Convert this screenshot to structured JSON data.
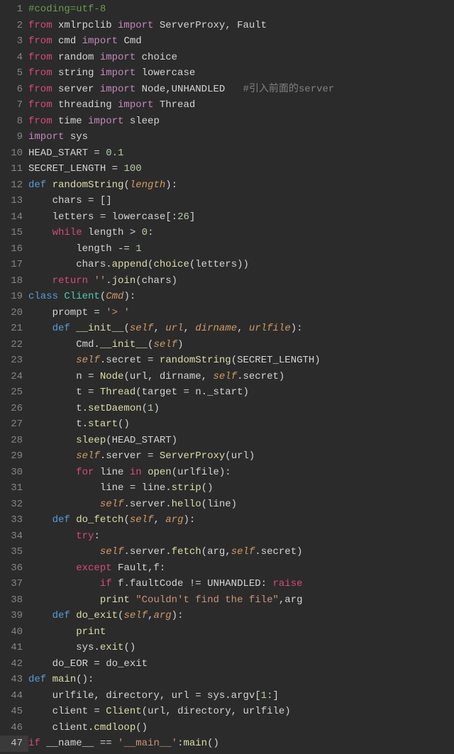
{
  "language": "python",
  "highlighted_line": 47,
  "lines": [
    {
      "n": 1,
      "tokens": [
        [
          "cm",
          "#coding=utf-8"
        ]
      ]
    },
    {
      "n": 2,
      "tokens": [
        [
          "kw-pink",
          "from"
        ],
        [
          "ident",
          " xmlrpclib "
        ],
        [
          "kw-import",
          "import"
        ],
        [
          "ident",
          " ServerProxy, Fault"
        ]
      ]
    },
    {
      "n": 3,
      "tokens": [
        [
          "kw-pink",
          "from"
        ],
        [
          "ident",
          " cmd "
        ],
        [
          "kw-import",
          "import"
        ],
        [
          "ident",
          " Cmd"
        ]
      ]
    },
    {
      "n": 4,
      "tokens": [
        [
          "kw-pink",
          "from"
        ],
        [
          "ident",
          " random "
        ],
        [
          "kw-import",
          "import"
        ],
        [
          "ident",
          " choice"
        ]
      ]
    },
    {
      "n": 5,
      "tokens": [
        [
          "kw-pink",
          "from"
        ],
        [
          "ident",
          " string "
        ],
        [
          "kw-import",
          "import"
        ],
        [
          "ident",
          " lowercase"
        ]
      ]
    },
    {
      "n": 6,
      "tokens": [
        [
          "kw-pink",
          "from"
        ],
        [
          "ident",
          " server "
        ],
        [
          "kw-import",
          "import"
        ],
        [
          "ident",
          " Node,UNHANDLED   "
        ],
        [
          "cm2",
          "#引入前面的server"
        ]
      ]
    },
    {
      "n": 7,
      "tokens": [
        [
          "kw-pink",
          "from"
        ],
        [
          "ident",
          " threading "
        ],
        [
          "kw-import",
          "import"
        ],
        [
          "ident",
          " Thread"
        ]
      ]
    },
    {
      "n": 8,
      "tokens": [
        [
          "kw-pink",
          "from"
        ],
        [
          "ident",
          " time "
        ],
        [
          "kw-import",
          "import"
        ],
        [
          "ident",
          " sleep"
        ]
      ]
    },
    {
      "n": 9,
      "tokens": [
        [
          "kw-import",
          "import"
        ],
        [
          "ident",
          " sys"
        ]
      ]
    },
    {
      "n": 10,
      "tokens": [
        [
          "ident",
          "HEAD_START "
        ],
        [
          "op",
          "="
        ],
        [
          "ident",
          " "
        ],
        [
          "num",
          "0.1"
        ]
      ]
    },
    {
      "n": 11,
      "tokens": [
        [
          "ident",
          "SECRET_LENGTH "
        ],
        [
          "op",
          "="
        ],
        [
          "ident",
          " "
        ],
        [
          "num",
          "100"
        ]
      ]
    },
    {
      "n": 12,
      "tokens": [
        [
          "kw-def",
          "def "
        ],
        [
          "fn",
          "randomString"
        ],
        [
          "op",
          "("
        ],
        [
          "self-ital",
          "length"
        ],
        [
          "op",
          "):"
        ]
      ]
    },
    {
      "n": 13,
      "tokens": [
        [
          "ident",
          "    chars "
        ],
        [
          "op",
          "="
        ],
        [
          "ident",
          " []"
        ]
      ]
    },
    {
      "n": 14,
      "tokens": [
        [
          "ident",
          "    letters "
        ],
        [
          "op",
          "="
        ],
        [
          "ident",
          " lowercase[:"
        ],
        [
          "num",
          "26"
        ],
        [
          "ident",
          "]"
        ]
      ]
    },
    {
      "n": 15,
      "tokens": [
        [
          "ident",
          "    "
        ],
        [
          "kw-pink",
          "while"
        ],
        [
          "ident",
          " length "
        ],
        [
          "op",
          ">"
        ],
        [
          "ident",
          " "
        ],
        [
          "num",
          "0"
        ],
        [
          "op",
          ":"
        ]
      ]
    },
    {
      "n": 16,
      "tokens": [
        [
          "ident",
          "        length "
        ],
        [
          "op",
          "-="
        ],
        [
          "ident",
          " "
        ],
        [
          "num",
          "1"
        ]
      ]
    },
    {
      "n": 17,
      "tokens": [
        [
          "ident",
          "        chars."
        ],
        [
          "meth",
          "append"
        ],
        [
          "op",
          "("
        ],
        [
          "meth",
          "choice"
        ],
        [
          "op",
          "("
        ],
        [
          "ident",
          "letters))"
        ]
      ]
    },
    {
      "n": 18,
      "tokens": [
        [
          "ident",
          "    "
        ],
        [
          "kw-pink",
          "return"
        ],
        [
          "ident",
          " "
        ],
        [
          "str",
          "''"
        ],
        [
          "ident",
          "."
        ],
        [
          "meth",
          "join"
        ],
        [
          "op",
          "("
        ],
        [
          "ident",
          "chars)"
        ]
      ]
    },
    {
      "n": 19,
      "tokens": [
        [
          "kw-def",
          "class "
        ],
        [
          "cls",
          "Client"
        ],
        [
          "op",
          "("
        ],
        [
          "self-ital",
          "Cmd"
        ],
        [
          "op",
          "):"
        ]
      ]
    },
    {
      "n": 20,
      "tokens": [
        [
          "ident",
          "    prompt "
        ],
        [
          "op",
          "="
        ],
        [
          "ident",
          " "
        ],
        [
          "str",
          "'> '"
        ]
      ]
    },
    {
      "n": 21,
      "tokens": [
        [
          "ident",
          "    "
        ],
        [
          "kw-def",
          "def "
        ],
        [
          "fn",
          "__init__"
        ],
        [
          "op",
          "("
        ],
        [
          "self-ital",
          "self"
        ],
        [
          "op",
          ", "
        ],
        [
          "self-ital",
          "url"
        ],
        [
          "op",
          ", "
        ],
        [
          "self-ital",
          "dirname"
        ],
        [
          "op",
          ", "
        ],
        [
          "self-ital",
          "urlfile"
        ],
        [
          "op",
          "):"
        ]
      ]
    },
    {
      "n": 22,
      "tokens": [
        [
          "ident",
          "        Cmd."
        ],
        [
          "meth",
          "__init__"
        ],
        [
          "op",
          "("
        ],
        [
          "self-ital",
          "self"
        ],
        [
          "op",
          ")"
        ]
      ]
    },
    {
      "n": 23,
      "tokens": [
        [
          "ident",
          "        "
        ],
        [
          "self-ital",
          "self"
        ],
        [
          "ident",
          ".secret "
        ],
        [
          "op",
          "="
        ],
        [
          "ident",
          " "
        ],
        [
          "meth",
          "randomString"
        ],
        [
          "op",
          "("
        ],
        [
          "ident",
          "SECRET_LENGTH)"
        ]
      ]
    },
    {
      "n": 24,
      "tokens": [
        [
          "ident",
          "        n "
        ],
        [
          "op",
          "="
        ],
        [
          "ident",
          " "
        ],
        [
          "meth",
          "Node"
        ],
        [
          "op",
          "("
        ],
        [
          "ident",
          "url, dirname, "
        ],
        [
          "self-ital",
          "self"
        ],
        [
          "ident",
          ".secret)"
        ]
      ]
    },
    {
      "n": 25,
      "tokens": [
        [
          "ident",
          "        t "
        ],
        [
          "op",
          "="
        ],
        [
          "ident",
          " "
        ],
        [
          "meth",
          "Thread"
        ],
        [
          "op",
          "("
        ],
        [
          "ident",
          "target "
        ],
        [
          "op",
          "="
        ],
        [
          "ident",
          " n._start)"
        ]
      ]
    },
    {
      "n": 26,
      "tokens": [
        [
          "ident",
          "        t."
        ],
        [
          "meth",
          "setDaemon"
        ],
        [
          "op",
          "("
        ],
        [
          "num",
          "1"
        ],
        [
          "op",
          ")"
        ]
      ]
    },
    {
      "n": 27,
      "tokens": [
        [
          "ident",
          "        t."
        ],
        [
          "meth",
          "start"
        ],
        [
          "op",
          "()"
        ]
      ]
    },
    {
      "n": 28,
      "tokens": [
        [
          "ident",
          "        "
        ],
        [
          "meth",
          "sleep"
        ],
        [
          "op",
          "("
        ],
        [
          "ident",
          "HEAD_START)"
        ]
      ]
    },
    {
      "n": 29,
      "tokens": [
        [
          "ident",
          "        "
        ],
        [
          "self-ital",
          "self"
        ],
        [
          "ident",
          ".server "
        ],
        [
          "op",
          "="
        ],
        [
          "ident",
          " "
        ],
        [
          "meth",
          "ServerProxy"
        ],
        [
          "op",
          "("
        ],
        [
          "ident",
          "url)"
        ]
      ]
    },
    {
      "n": 30,
      "tokens": [
        [
          "ident",
          "        "
        ],
        [
          "kw-pink",
          "for"
        ],
        [
          "ident",
          " line "
        ],
        [
          "kw-pink",
          "in"
        ],
        [
          "ident",
          " "
        ],
        [
          "builtin",
          "open"
        ],
        [
          "op",
          "("
        ],
        [
          "ident",
          "urlfile):"
        ]
      ]
    },
    {
      "n": 31,
      "tokens": [
        [
          "ident",
          "            line "
        ],
        [
          "op",
          "="
        ],
        [
          "ident",
          " line."
        ],
        [
          "meth",
          "strip"
        ],
        [
          "op",
          "()"
        ]
      ]
    },
    {
      "n": 32,
      "tokens": [
        [
          "ident",
          "            "
        ],
        [
          "self-ital",
          "self"
        ],
        [
          "ident",
          ".server."
        ],
        [
          "meth",
          "hello"
        ],
        [
          "op",
          "("
        ],
        [
          "ident",
          "line)"
        ]
      ]
    },
    {
      "n": 33,
      "tokens": [
        [
          "ident",
          "    "
        ],
        [
          "kw-def",
          "def "
        ],
        [
          "fn",
          "do_fetch"
        ],
        [
          "op",
          "("
        ],
        [
          "self-ital",
          "self"
        ],
        [
          "op",
          ", "
        ],
        [
          "self-ital",
          "arg"
        ],
        [
          "op",
          "):"
        ]
      ]
    },
    {
      "n": 34,
      "tokens": [
        [
          "ident",
          "        "
        ],
        [
          "kw-pink",
          "try"
        ],
        [
          "op",
          ":"
        ]
      ]
    },
    {
      "n": 35,
      "tokens": [
        [
          "ident",
          "            "
        ],
        [
          "self-ital",
          "self"
        ],
        [
          "ident",
          ".server."
        ],
        [
          "meth",
          "fetch"
        ],
        [
          "op",
          "("
        ],
        [
          "ident",
          "arg,"
        ],
        [
          "self-ital",
          "self"
        ],
        [
          "ident",
          ".secret)"
        ]
      ]
    },
    {
      "n": 36,
      "tokens": [
        [
          "ident",
          "        "
        ],
        [
          "kw-pink",
          "except"
        ],
        [
          "ident",
          " Fault,f:"
        ]
      ]
    },
    {
      "n": 37,
      "tokens": [
        [
          "ident",
          "            "
        ],
        [
          "kw-pink",
          "if"
        ],
        [
          "ident",
          " f.faultCode "
        ],
        [
          "op",
          "!="
        ],
        [
          "ident",
          " UNHANDLED: "
        ],
        [
          "kw-pink",
          "raise"
        ]
      ]
    },
    {
      "n": 38,
      "tokens": [
        [
          "ident",
          "            "
        ],
        [
          "builtin",
          "print"
        ],
        [
          "ident",
          " "
        ],
        [
          "str",
          "\"Couldn't find the file\""
        ],
        [
          "ident",
          ",arg"
        ]
      ]
    },
    {
      "n": 39,
      "tokens": [
        [
          "ident",
          "    "
        ],
        [
          "kw-def",
          "def "
        ],
        [
          "fn",
          "do_exit"
        ],
        [
          "op",
          "("
        ],
        [
          "self-ital",
          "self"
        ],
        [
          "op",
          ","
        ],
        [
          "self-ital",
          "arg"
        ],
        [
          "op",
          "):"
        ]
      ]
    },
    {
      "n": 40,
      "tokens": [
        [
          "ident",
          "        "
        ],
        [
          "builtin",
          "print"
        ]
      ]
    },
    {
      "n": 41,
      "tokens": [
        [
          "ident",
          "        sys."
        ],
        [
          "meth",
          "exit"
        ],
        [
          "op",
          "()"
        ]
      ]
    },
    {
      "n": 42,
      "tokens": [
        [
          "ident",
          "    do_EOR "
        ],
        [
          "op",
          "="
        ],
        [
          "ident",
          " do_exit"
        ]
      ]
    },
    {
      "n": 43,
      "tokens": [
        [
          "kw-def",
          "def "
        ],
        [
          "fn",
          "main"
        ],
        [
          "op",
          "():"
        ]
      ]
    },
    {
      "n": 44,
      "tokens": [
        [
          "ident",
          "    urlfile, directory, url "
        ],
        [
          "op",
          "="
        ],
        [
          "ident",
          " sys.argv["
        ],
        [
          "num",
          "1"
        ],
        [
          "ident",
          ":]"
        ]
      ]
    },
    {
      "n": 45,
      "tokens": [
        [
          "ident",
          "    client "
        ],
        [
          "op",
          "="
        ],
        [
          "ident",
          " "
        ],
        [
          "meth",
          "Client"
        ],
        [
          "op",
          "("
        ],
        [
          "ident",
          "url, directory, urlfile)"
        ]
      ]
    },
    {
      "n": 46,
      "tokens": [
        [
          "ident",
          "    client."
        ],
        [
          "meth",
          "cmdloop"
        ],
        [
          "op",
          "()"
        ]
      ]
    },
    {
      "n": 47,
      "tokens": [
        [
          "kw-pink",
          "if"
        ],
        [
          "ident",
          " __name__ "
        ],
        [
          "op",
          "=="
        ],
        [
          "ident",
          " "
        ],
        [
          "str",
          "'__main__'"
        ],
        [
          "ident",
          ":"
        ],
        [
          "meth",
          "main"
        ],
        [
          "op",
          "()"
        ]
      ]
    }
  ]
}
